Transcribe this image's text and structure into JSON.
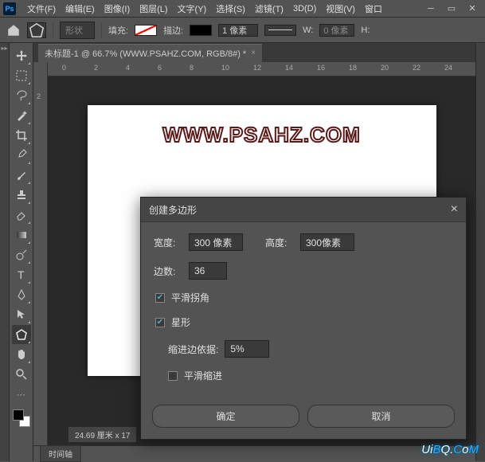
{
  "menu": {
    "items": [
      "文件(F)",
      "编辑(E)",
      "图像(I)",
      "图层(L)",
      "文字(Y)",
      "选择(S)",
      "滤镜(T)",
      "3D(D)",
      "视图(V)",
      "窗口"
    ]
  },
  "options": {
    "shape_dropdown": "形状",
    "fill_label": "填充:",
    "stroke_label": "描边:",
    "stroke_width": "1 像素",
    "w_label": "W:",
    "w_value": "0 像素",
    "h_label": "H:"
  },
  "tab": {
    "title": "未标题-1 @ 66.7% (WWW.PSAHZ.COM, RGB/8#) *"
  },
  "ruler_h": [
    "0",
    "2",
    "4",
    "6",
    "8",
    "10",
    "12",
    "14",
    "16",
    "18",
    "20",
    "22",
    "24"
  ],
  "ruler_v": [
    "2"
  ],
  "canvas": {
    "watermark": "WWW.PSAHZ.COM"
  },
  "dialog": {
    "title": "创建多边形",
    "width_label": "宽度:",
    "width_value": "300 像素",
    "height_label": "高度:",
    "height_value": "300像素",
    "sides_label": "边数:",
    "sides_value": "36",
    "smooth_corners": "平滑拐角",
    "smooth_corners_checked": true,
    "star": "星形",
    "star_checked": true,
    "indent_label": "缩进边依据:",
    "indent_value": "5%",
    "smooth_indent": "平滑缩进",
    "smooth_indent_checked": false,
    "ok": "确定",
    "cancel": "取消"
  },
  "status": {
    "dimensions": "24.69 厘米 x 17",
    "timeline": "时间轴"
  },
  "watermark_site": "UiBQ.CoM"
}
